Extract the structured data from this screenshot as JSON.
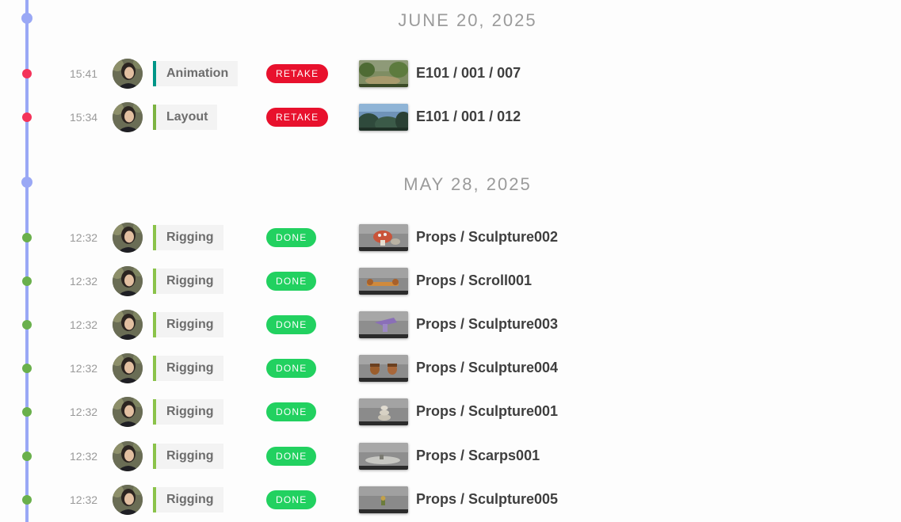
{
  "colors": {
    "timeline": "#9aa8f5",
    "retake": "#e8112d",
    "done": "#22d160",
    "animation_bar": "#009688",
    "layout_bar": "#7cb342",
    "rigging_bar": "#8bc34a",
    "retake_dot": "#f4335a",
    "done_dot": "#6ab04c"
  },
  "days": [
    {
      "date": "JUNE 20, 2025",
      "entries": [
        {
          "time": "15:41",
          "task": "Animation",
          "task_color": "#009688",
          "status": "RETAKE",
          "status_color": "#e8112d",
          "dot_color": "#f4335a",
          "thumb": "forest-path",
          "entity": "E101 / 001 / 007"
        },
        {
          "time": "15:34",
          "task": "Layout",
          "task_color": "#7cb342",
          "status": "RETAKE",
          "status_color": "#e8112d",
          "dot_color": "#f4335a",
          "thumb": "forest-sky",
          "entity": "E101 / 001 / 012"
        }
      ]
    },
    {
      "date": "MAY 28, 2025",
      "entries": [
        {
          "time": "12:32",
          "task": "Rigging",
          "task_color": "#8bc34a",
          "status": "DONE",
          "status_color": "#22d160",
          "dot_color": "#6ab04c",
          "thumb": "mushroom",
          "entity": "Props / Sculpture002"
        },
        {
          "time": "12:32",
          "task": "Rigging",
          "task_color": "#8bc34a",
          "status": "DONE",
          "status_color": "#22d160",
          "dot_color": "#6ab04c",
          "thumb": "scroll",
          "entity": "Props / Scroll001"
        },
        {
          "time": "12:32",
          "task": "Rigging",
          "task_color": "#8bc34a",
          "status": "DONE",
          "status_color": "#22d160",
          "dot_color": "#6ab04c",
          "thumb": "purple-shape",
          "entity": "Props / Sculpture003"
        },
        {
          "time": "12:32",
          "task": "Rigging",
          "task_color": "#8bc34a",
          "status": "DONE",
          "status_color": "#22d160",
          "dot_color": "#6ab04c",
          "thumb": "acorns",
          "entity": "Props / Sculpture004"
        },
        {
          "time": "12:32",
          "task": "Rigging",
          "task_color": "#8bc34a",
          "status": "DONE",
          "status_color": "#22d160",
          "dot_color": "#6ab04c",
          "thumb": "stones",
          "entity": "Props / Sculpture001"
        },
        {
          "time": "12:32",
          "task": "Rigging",
          "task_color": "#8bc34a",
          "status": "DONE",
          "status_color": "#22d160",
          "dot_color": "#6ab04c",
          "thumb": "scarps",
          "entity": "Props / Scarps001"
        },
        {
          "time": "12:32",
          "task": "Rigging",
          "task_color": "#8bc34a",
          "status": "DONE",
          "status_color": "#22d160",
          "dot_color": "#6ab04c",
          "thumb": "small-prop",
          "entity": "Props / Sculpture005"
        }
      ]
    }
  ]
}
